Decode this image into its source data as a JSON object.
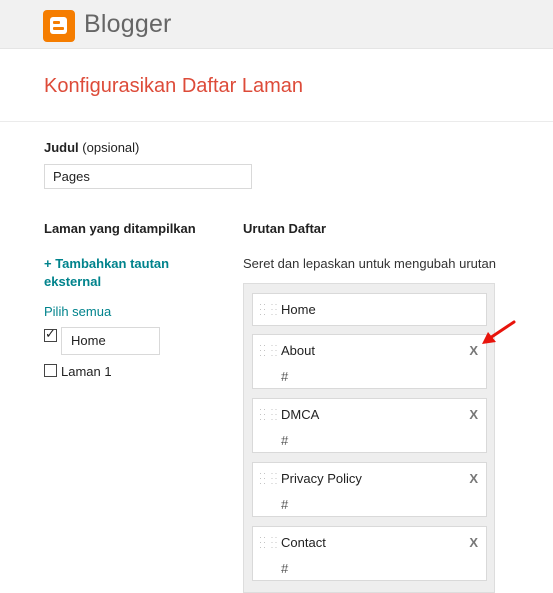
{
  "app": {
    "brand": "Blogger"
  },
  "page_title": "Konfigurasikan Daftar Laman",
  "judul": {
    "label_bold": "Judul",
    "label_rest": " (opsional)",
    "value": "Pages"
  },
  "left_column": {
    "title": "Laman yang ditampilkan",
    "add_link": "+ Tambahkan tautan eksternal",
    "select_all": "Pilih semua",
    "pages": [
      {
        "label": "Home",
        "checked": true
      },
      {
        "label": "Laman 1",
        "checked": false
      }
    ]
  },
  "right_column": {
    "title": "Urutan Daftar",
    "hint": "Seret dan lepaskan untuk mengubah urutan",
    "items": [
      {
        "title": "Home",
        "url": "",
        "remove": ""
      },
      {
        "title": "About",
        "url": "#",
        "remove": "X"
      },
      {
        "title": "DMCA",
        "url": "#",
        "remove": "X"
      },
      {
        "title": "Privacy Policy",
        "url": "#",
        "remove": "X"
      },
      {
        "title": "Contact",
        "url": "#",
        "remove": "X"
      }
    ]
  },
  "annotation": {
    "arrow_color": "#e8140c"
  }
}
